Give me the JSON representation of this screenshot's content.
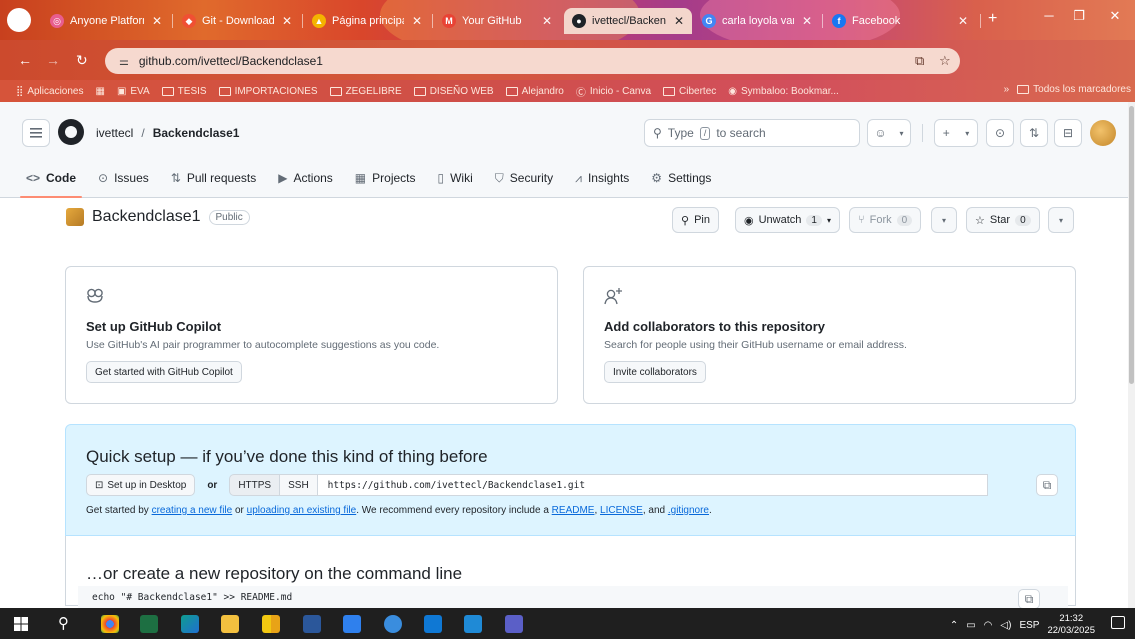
{
  "browser": {
    "tabs": [
      {
        "label": "Anyone Platform",
        "favicon_color": "#e85d8e",
        "active": false
      },
      {
        "label": "Git - Downloadi",
        "favicon_color": "#f05033",
        "active": false
      },
      {
        "label": "Página principal",
        "favicon_color": "#f4b400",
        "active": false
      },
      {
        "label": "Your GitHub",
        "favicon_color": "#e94335",
        "active": false
      },
      {
        "label": "ivettecl/Backend",
        "favicon_color": "#1f2328",
        "active": true
      },
      {
        "label": "carla loyola van",
        "favicon_color": "#4285f4",
        "active": false
      },
      {
        "label": "Facebook",
        "favicon_color": "#1877f2",
        "active": false
      }
    ],
    "url": "github.com/ivettecl/Backendclase1",
    "bookmarks": [
      {
        "label": "Aplicaciones"
      },
      {
        "label": "EVA"
      },
      {
        "label": "TESIS"
      },
      {
        "label": "IMPORTACIONES"
      },
      {
        "label": "ZEGELIBRE"
      },
      {
        "label": "DISEÑO WEB"
      },
      {
        "label": "Alejandro"
      },
      {
        "label": "Inicio - Canva"
      },
      {
        "label": "Cibertec"
      },
      {
        "label": "Symbaloo: Bookmar..."
      }
    ],
    "bookmarks_more": "»",
    "all_bookmarks": "Todos los marcadores"
  },
  "github": {
    "owner": "ivettecl",
    "repo": "Backendclase1",
    "search_prefix": "Type",
    "search_key": "/",
    "search_suffix": "to search",
    "nav": [
      {
        "label": "Code",
        "icon": "code-icon",
        "glyph": "<>",
        "selected": true
      },
      {
        "label": "Issues",
        "icon": "issue-icon",
        "glyph": "⊙",
        "selected": false
      },
      {
        "label": "Pull requests",
        "icon": "pull-request-icon",
        "glyph": "⇅",
        "selected": false
      },
      {
        "label": "Actions",
        "icon": "actions-icon",
        "glyph": "▶",
        "selected": false
      },
      {
        "label": "Projects",
        "icon": "projects-icon",
        "glyph": "▦",
        "selected": false
      },
      {
        "label": "Wiki",
        "icon": "wiki-icon",
        "glyph": "▯",
        "selected": false
      },
      {
        "label": "Security",
        "icon": "shield-icon",
        "glyph": "⛉",
        "selected": false
      },
      {
        "label": "Insights",
        "icon": "graph-icon",
        "glyph": "⩘",
        "selected": false
      },
      {
        "label": "Settings",
        "icon": "gear-icon",
        "glyph": "⚙",
        "selected": false
      }
    ],
    "repo_header": {
      "name": "Backendclase1",
      "visibility": "Public",
      "pin": "Pin",
      "unwatch": "Unwatch",
      "watch_count": "1",
      "fork": "Fork",
      "fork_count": "0",
      "star": "Star",
      "star_count": "0"
    },
    "cards": {
      "copilot": {
        "title": "Set up GitHub Copilot",
        "desc": "Use GitHub's AI pair programmer to autocomplete suggestions as you code.",
        "button": "Get started with GitHub Copilot"
      },
      "collab": {
        "title": "Add collaborators to this repository",
        "desc": "Search for people using their GitHub username or email address.",
        "button": "Invite collaborators"
      }
    },
    "quick_setup": {
      "title": "Quick setup — if you’ve done this kind of thing before",
      "desktop": "Set up in Desktop",
      "or": "or",
      "https": "HTTPS",
      "ssh": "SSH",
      "clone_url": "https://github.com/ivettecl/Backendclase1.git",
      "help_prefix": "Get started by",
      "link_new_file": "creating a new file",
      "help_or": "or",
      "link_upload": "uploading an existing file",
      "help_mid": ". We recommend every repository include a",
      "link_readme": "README",
      "link_license": "LICENSE",
      "help_and": ", and",
      "link_gitignore": ".gitignore",
      "help_end": "."
    },
    "command_line": {
      "title": "…or create a new repository on the command line",
      "code": "echo \"# Backendclase1\" >> README.md"
    }
  },
  "taskbar": {
    "language": "ESP",
    "time": "21:32",
    "date": "22/03/2025"
  }
}
